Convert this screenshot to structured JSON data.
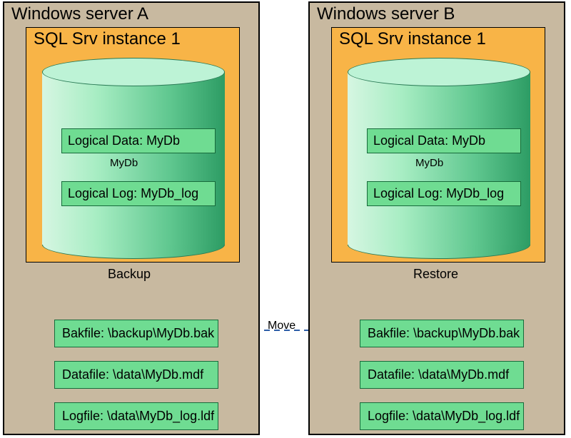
{
  "serverA": {
    "title": "Windows server A",
    "sqlTitle": "SQL Srv instance 1",
    "logicalData": "Logical Data: MyDb",
    "dbName": "MyDb",
    "logicalLog": "Logical Log: MyDb_log",
    "opLabel": "Backup",
    "bakfile": "Bakfile: \\backup\\MyDb.bak",
    "datafile": "Datafile: \\data\\MyDb.mdf",
    "logfile": "Logfile: \\data\\MyDb_log.ldf"
  },
  "serverB": {
    "title": "Windows server B",
    "sqlTitle": "SQL Srv instance 1",
    "logicalData": "Logical Data: MyDb",
    "dbName": "MyDb",
    "logicalLog": "Logical Log: MyDb_log",
    "opLabel": "Restore",
    "bakfile": "Bakfile: \\backup\\MyDb.bak",
    "datafile": "Datafile: \\data\\MyDb.mdf",
    "logfile": "Logfile: \\data\\MyDb_log.ldf"
  },
  "transfer": {
    "moveLabel": "Move"
  }
}
